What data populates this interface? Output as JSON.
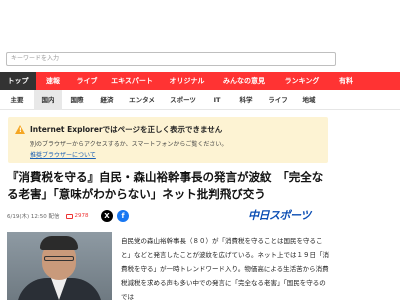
{
  "search": {
    "placeholder": "キーワードを入力"
  },
  "main_nav": [
    {
      "label": "トップ",
      "active": true
    },
    {
      "label": "速報"
    },
    {
      "label": "ライブ"
    },
    {
      "label": "エキスパート"
    },
    {
      "label": "オリジナル"
    },
    {
      "label": "みんなの意見"
    },
    {
      "label": "ランキング"
    },
    {
      "label": "有料"
    }
  ],
  "sub_nav": [
    {
      "label": "主要"
    },
    {
      "label": "国内",
      "active": true
    },
    {
      "label": "国際"
    },
    {
      "label": "経済"
    },
    {
      "label": "エンタメ"
    },
    {
      "label": "スポーツ"
    },
    {
      "label": "IT"
    },
    {
      "label": "科学"
    },
    {
      "label": "ライフ"
    },
    {
      "label": "地域"
    }
  ],
  "ie_notice": {
    "icon": "warning-icon",
    "title": "Internet Explorerではページを正しく表示できません",
    "message": "別のブラウザーからアクセスするか、スマートフォンからご覧ください。",
    "link": "推奨ブラウザーについて"
  },
  "article": {
    "headline": "『消費税を守る』自民・森山裕幹事長の発言が波紋　「完全なる老害」「意味がわからない」ネット批判飛び交う",
    "date": "6/19(木) 12:50 配信",
    "comment_count": "2978",
    "share": {
      "x": "X",
      "facebook": "f"
    },
    "source": "中日スポーツ",
    "body": "自民党の森山裕幹事長（８０）が「消費税を守ることは国民を守ること」などと発言したことが波紋を広げている。ネット上では１９日「消費税を守る」が一時トレンドワード入り。物価高による生活苦から消費税減税を求める声も多い中での発言に「完全なる老害」「国民を守るのでは"
  },
  "colors": {
    "accent": "#ff3333",
    "nav_active": "#333333",
    "notice_bg": "#fdf3d3",
    "brand": "#0a4db3"
  }
}
